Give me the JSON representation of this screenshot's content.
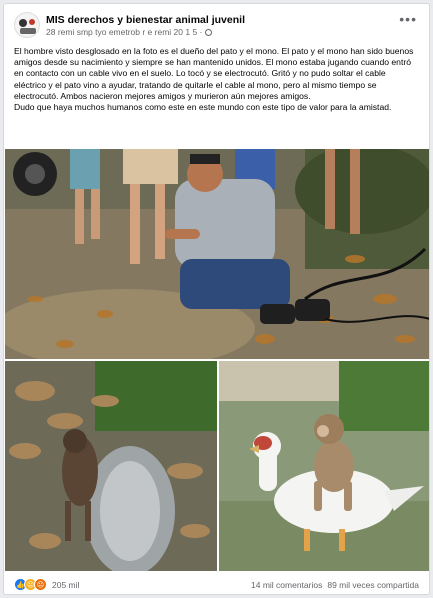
{
  "post": {
    "page_name": "MIS derechos y bienestar animal juvenil",
    "meta_text": "28 remi smp tyo emetrob r e remi 20 1 5 ·",
    "text_paragraph_1": "El hombre visto desglosado en la foto es el dueño del pato y el mono. El pato y el mono han sido buenos amigos desde su nacimiento y siempre se han mantenido unidos. El mono estaba jugando cuando entró en contacto con un cable vivo en el suelo. Lo tocó y se electrocutó. Gritó y no pudo soltar el cable eléctrico y el pato vino a ayudar, tratando de quitarle el cable al mono, pero al mismo tiempo se electrocutó. Ambos nacieron mejores amigos y murieron aún mejores amigos.",
    "text_paragraph_2": "Dudo que haya muchos humanos como este en este mundo con este tipo de valor para la amistad."
  },
  "footer": {
    "reaction_count": "205 mil",
    "comments": "14 mil comentarios",
    "shares": "89 mil veces compartida"
  },
  "icons": {
    "more": "more-options-icon",
    "privacy": "globe-icon",
    "like": "like-reaction-icon",
    "sad": "sad-reaction-icon",
    "angry": "angry-reaction-icon"
  },
  "colors": {
    "like": "#1877f2",
    "sad": "#f7b125",
    "angry": "#e9710f"
  }
}
